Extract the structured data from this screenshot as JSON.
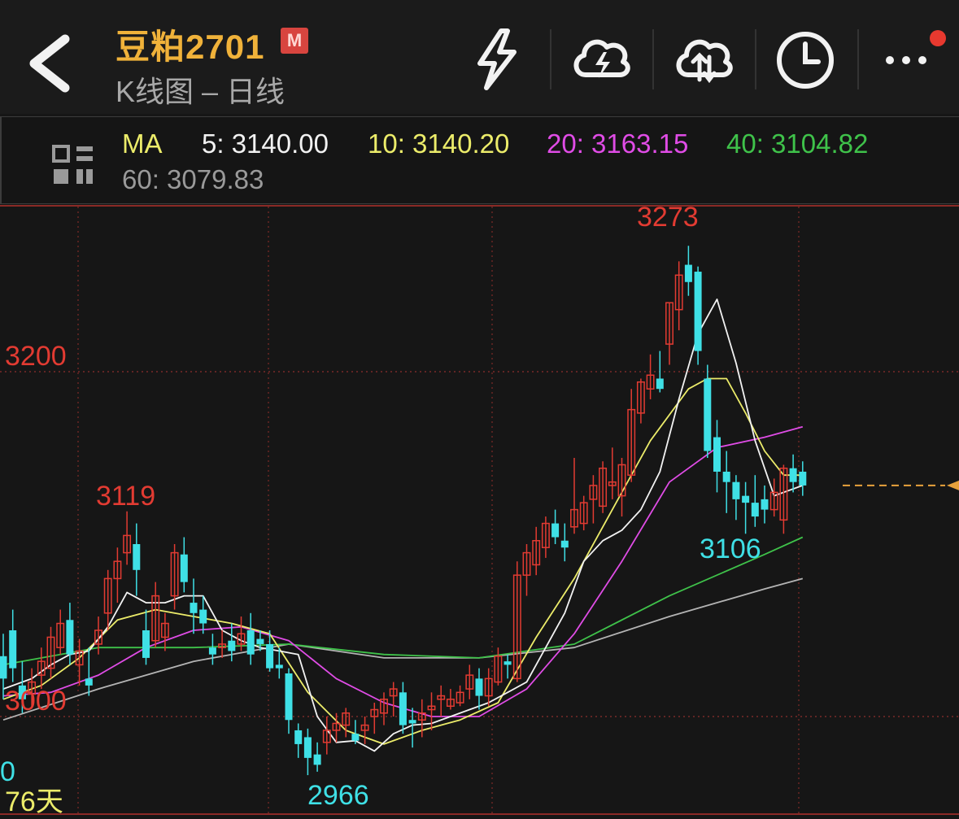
{
  "header": {
    "title": "豆粕2701",
    "badge": "M",
    "subtitle": "K线图 – 日线"
  },
  "toolbar": {
    "icons": [
      "back-icon",
      "lightning-icon",
      "cloud-lightning-icon",
      "cloud-transfer-icon",
      "clock-icon",
      "more-icon"
    ]
  },
  "ma_bar": {
    "label": "MA",
    "ma5": "5: 3140.00",
    "ma10": "10: 3140.20",
    "ma20": "20: 3163.15",
    "ma40": "40: 3104.82",
    "ma60": "60: 3079.83"
  },
  "colors": {
    "up": "#e23b32",
    "down": "#3fe0e6",
    "ma5": "#f2f2f2",
    "ma10": "#ecec6a",
    "ma20": "#e04ce6",
    "ma40": "#3fc24a",
    "ma60": "#b4b4b4",
    "title": "#f0b23a",
    "current_price_marker": "#e8a23c"
  },
  "chart_data": {
    "type": "candlestick",
    "period": "日线",
    "y_ticks": [
      {
        "value": 3200,
        "label": "3200"
      },
      {
        "value": 3000,
        "label": "3000"
      }
    ],
    "annotations": [
      {
        "label": "3273",
        "value": 3273,
        "kind": "high"
      },
      {
        "label": "3119",
        "value": 3119,
        "kind": "high"
      },
      {
        "label": "3106",
        "value": 3106,
        "kind": "low"
      },
      {
        "label": "2966",
        "value": 2966,
        "kind": "low"
      }
    ],
    "bottom_label": "76天",
    "left_edge_label": "0",
    "candles": [
      [
        3035,
        3048,
        3010,
        3022
      ],
      [
        3050,
        3062,
        3020,
        3028
      ],
      [
        3018,
        3032,
        3002,
        3010
      ],
      [
        3013,
        3028,
        3006,
        3020
      ],
      [
        3024,
        3040,
        3016,
        3032
      ],
      [
        3028,
        3052,
        3022,
        3046
      ],
      [
        3040,
        3062,
        3036,
        3054
      ],
      [
        3056,
        3066,
        3030,
        3036
      ],
      [
        3030,
        3045,
        3018,
        3038
      ],
      [
        3022,
        3040,
        3012,
        3018
      ],
      [
        3042,
        3058,
        3036,
        3050
      ],
      [
        3060,
        3085,
        3050,
        3080
      ],
      [
        3080,
        3098,
        3066,
        3090
      ],
      [
        3095,
        3119,
        3088,
        3105
      ],
      [
        3100,
        3112,
        3070,
        3085
      ],
      [
        3050,
        3062,
        3030,
        3034
      ],
      [
        3044,
        3078,
        3040,
        3070
      ],
      [
        3046,
        3060,
        3038,
        3054
      ],
      [
        3070,
        3100,
        3062,
        3095
      ],
      [
        3094,
        3104,
        3072,
        3078
      ],
      [
        3066,
        3080,
        3048,
        3060
      ],
      [
        3062,
        3070,
        3048,
        3054
      ],
      [
        3040,
        3048,
        3030,
        3036
      ],
      [
        3040,
        3050,
        3034,
        3042
      ],
      [
        3044,
        3054,
        3032,
        3038
      ],
      [
        3042,
        3058,
        3038,
        3048
      ],
      [
        3050,
        3060,
        3030,
        3036
      ],
      [
        3045,
        3050,
        3038,
        3042
      ],
      [
        3042,
        3050,
        3026,
        3028
      ],
      [
        3030,
        3040,
        3022,
        3028
      ],
      [
        3025,
        3028,
        2990,
        2998
      ],
      [
        2992,
        2996,
        2976,
        2984
      ],
      [
        2988,
        2993,
        2966,
        2976
      ],
      [
        2978,
        2985,
        2968,
        2972
      ],
      [
        2985,
        3000,
        2978,
        2992
      ],
      [
        2992,
        3002,
        2985,
        2996
      ],
      [
        2995,
        3005,
        2988,
        3002
      ],
      [
        2990,
        2998,
        2984,
        2986
      ],
      [
        2992,
        3000,
        2984,
        2995
      ],
      [
        3000,
        3008,
        2990,
        3004
      ],
      [
        3002,
        3014,
        2995,
        3010
      ],
      [
        3012,
        3020,
        3000,
        3016
      ],
      [
        3014,
        3020,
        2990,
        2995
      ],
      [
        2998,
        3005,
        2982,
        2996
      ],
      [
        2998,
        3010,
        2988,
        3002
      ],
      [
        3004,
        3014,
        2992,
        3006
      ],
      [
        3010,
        3018,
        3000,
        3012
      ],
      [
        3006,
        3016,
        3004,
        3010
      ],
      [
        3008,
        3018,
        3006,
        3014
      ],
      [
        3016,
        3030,
        3010,
        3024
      ],
      [
        3022,
        3028,
        3004,
        3012
      ],
      [
        3012,
        3028,
        3006,
        3022
      ],
      [
        3020,
        3040,
        3018,
        3035
      ],
      [
        3032,
        3036,
        3022,
        3030
      ],
      [
        3022,
        3090,
        3020,
        3082
      ],
      [
        3082,
        3100,
        3070,
        3095
      ],
      [
        3088,
        3110,
        3082,
        3102
      ],
      [
        3098,
        3116,
        3092,
        3112
      ],
      [
        3112,
        3120,
        3100,
        3104
      ],
      [
        3102,
        3112,
        3090,
        3098
      ],
      [
        3110,
        3150,
        3106,
        3120
      ],
      [
        3112,
        3128,
        3108,
        3124
      ],
      [
        3126,
        3140,
        3112,
        3134
      ],
      [
        3122,
        3148,
        3118,
        3144
      ],
      [
        3134,
        3156,
        3126,
        3136
      ],
      [
        3128,
        3150,
        3116,
        3146
      ],
      [
        3140,
        3190,
        3136,
        3178
      ],
      [
        3176,
        3196,
        3170,
        3194
      ],
      [
        3190,
        3210,
        3184,
        3198
      ],
      [
        3196,
        3212,
        3188,
        3190
      ],
      [
        3216,
        3240,
        3204,
        3240
      ],
      [
        3236,
        3264,
        3224,
        3256
      ],
      [
        3262,
        3273,
        3244,
        3252
      ],
      [
        3258,
        3261,
        3204,
        3212
      ],
      [
        3196,
        3204,
        3150,
        3154
      ],
      [
        3162,
        3172,
        3130,
        3142
      ],
      [
        3142,
        3154,
        3118,
        3136
      ],
      [
        3136,
        3140,
        3114,
        3126
      ],
      [
        3128,
        3136,
        3106,
        3124
      ],
      [
        3124,
        3140,
        3110,
        3116
      ],
      [
        3126,
        3134,
        3112,
        3120
      ],
      [
        3120,
        3138,
        3116,
        3130
      ],
      [
        3114,
        3146,
        3106,
        3144
      ],
      [
        3144,
        3152,
        3130,
        3136
      ],
      [
        3142,
        3148,
        3128,
        3134
      ]
    ],
    "ma_lines": [
      {
        "name": "MA5",
        "x": [
          0,
          3,
          5,
          7,
          9,
          11,
          13,
          15,
          17,
          19,
          21,
          23,
          25,
          27,
          29,
          31,
          33,
          35,
          37,
          39,
          41,
          43,
          45,
          47,
          49,
          51,
          53,
          55,
          57,
          59,
          61,
          63,
          65,
          67,
          69,
          71,
          73,
          75,
          77,
          79,
          81,
          84
        ],
        "y": [
          3016,
          3022,
          3030,
          3036,
          3038,
          3052,
          3072,
          3066,
          3066,
          3070,
          3070,
          3050,
          3044,
          3040,
          3038,
          3036,
          3000,
          2985,
          2986,
          2980,
          2990,
          2995,
          2996,
          3000,
          3004,
          3008,
          3014,
          3020,
          3040,
          3060,
          3090,
          3102,
          3108,
          3120,
          3142,
          3184,
          3222,
          3242,
          3205,
          3160,
          3128,
          3134
        ]
      },
      {
        "name": "MA10",
        "x": [
          0,
          4,
          8,
          12,
          16,
          20,
          24,
          28,
          32,
          36,
          40,
          44,
          48,
          52,
          56,
          60,
          64,
          68,
          72,
          74,
          76,
          78,
          80,
          82,
          84
        ],
        "y": [
          3010,
          3018,
          3034,
          3056,
          3062,
          3058,
          3054,
          3048,
          3014,
          2992,
          2984,
          2992,
          2998,
          3008,
          3046,
          3080,
          3120,
          3160,
          3190,
          3196,
          3196,
          3176,
          3154,
          3140,
          3140
        ]
      },
      {
        "name": "MA20",
        "x": [
          0,
          5,
          10,
          15,
          20,
          25,
          30,
          35,
          40,
          45,
          50,
          55,
          60,
          65,
          70,
          75,
          80,
          84
        ],
        "y": [
          3012,
          3014,
          3024,
          3040,
          3050,
          3052,
          3044,
          3022,
          3008,
          3000,
          3000,
          3016,
          3048,
          3090,
          3136,
          3156,
          3162,
          3168
        ]
      },
      {
        "name": "MA40",
        "x": [
          0,
          10,
          20,
          30,
          40,
          50,
          60,
          70,
          80,
          84
        ],
        "y": [
          3030,
          3040,
          3040,
          3042,
          3036,
          3034,
          3042,
          3070,
          3094,
          3104
        ]
      },
      {
        "name": "MA60",
        "x": [
          0,
          10,
          20,
          30,
          40,
          50,
          60,
          70,
          80,
          84
        ],
        "y": [
          2998,
          3016,
          3032,
          3042,
          3034,
          3034,
          3040,
          3058,
          3074,
          3080
        ]
      }
    ]
  }
}
